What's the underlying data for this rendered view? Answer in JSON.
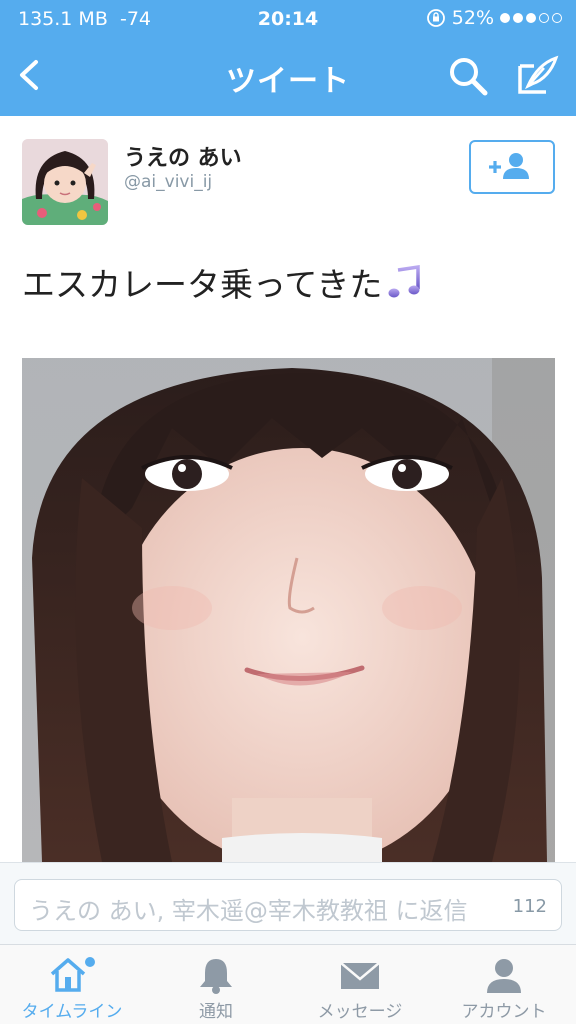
{
  "status_bar": {
    "memory": "135.1 MB",
    "signal": "-74",
    "time": "20:14",
    "battery": "52%"
  },
  "nav": {
    "title": "ツイート",
    "back_icon": "chevron-left-icon",
    "search_icon": "search-icon",
    "compose_icon": "compose-quill-icon"
  },
  "tweet": {
    "author_name": "うえの あい",
    "author_handle": "@ai_vivi_ij",
    "text": "エスカレータ乗ってきた",
    "emoji": "music-note-icon"
  },
  "follow_button": {
    "icon": "add-user-icon"
  },
  "reply": {
    "placeholder": "うえの あい, 宰木遥@宰木教教祖 に返信",
    "char_count": "112"
  },
  "tabs": [
    {
      "label": "タイムライン",
      "icon": "home-icon",
      "active": true
    },
    {
      "label": "通知",
      "icon": "bell-icon",
      "active": false
    },
    {
      "label": "メッセージ",
      "icon": "envelope-icon",
      "active": false
    },
    {
      "label": "アカウント",
      "icon": "person-icon",
      "active": false
    }
  ],
  "colors": {
    "accent": "#55acee",
    "tab_inactive": "#8e9aa6"
  }
}
